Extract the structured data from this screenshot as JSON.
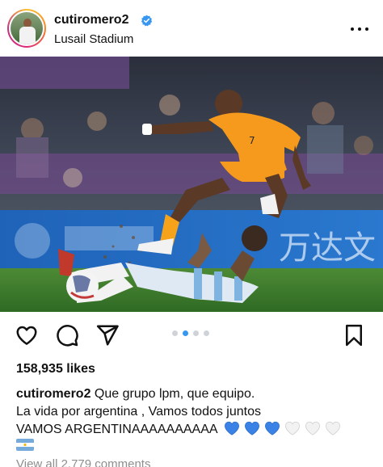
{
  "header": {
    "username": "cutiromero2",
    "location": "Lusail Stadium",
    "verified": true,
    "more_icon": "more-horizontal-icon"
  },
  "photo": {
    "board_text": "万达文",
    "player_number": "7"
  },
  "actions": {
    "icons": [
      "heart-icon",
      "comment-icon",
      "share-icon",
      "bookmark-icon"
    ],
    "carousel_count": 4,
    "carousel_active": 2
  },
  "likes": "158,935 likes",
  "caption": {
    "username": "cutiromero2",
    "line1": "Que grupo lpm, que equipo.",
    "line2": "La vida por argentina , Vamos todos juntos",
    "line3": "VAMOS ARGENTINAAAAAAAAAA",
    "emojis": [
      {
        "type": "blue-heart",
        "color": "#3b82e6"
      },
      {
        "type": "blue-heart",
        "color": "#3b82e6"
      },
      {
        "type": "blue-heart",
        "color": "#3b82e6"
      },
      {
        "type": "white-heart",
        "color": "#f2f2f2"
      },
      {
        "type": "white-heart",
        "color": "#f2f2f2"
      },
      {
        "type": "white-heart",
        "color": "#f2f2f2"
      }
    ],
    "flag": "argentina-flag"
  },
  "comments_link": "View all 2,779 comments",
  "colors": {
    "accent_blue": "#3897f0",
    "orange_kit": "#f59a1c",
    "pitch_green": "#3c7a2c"
  }
}
